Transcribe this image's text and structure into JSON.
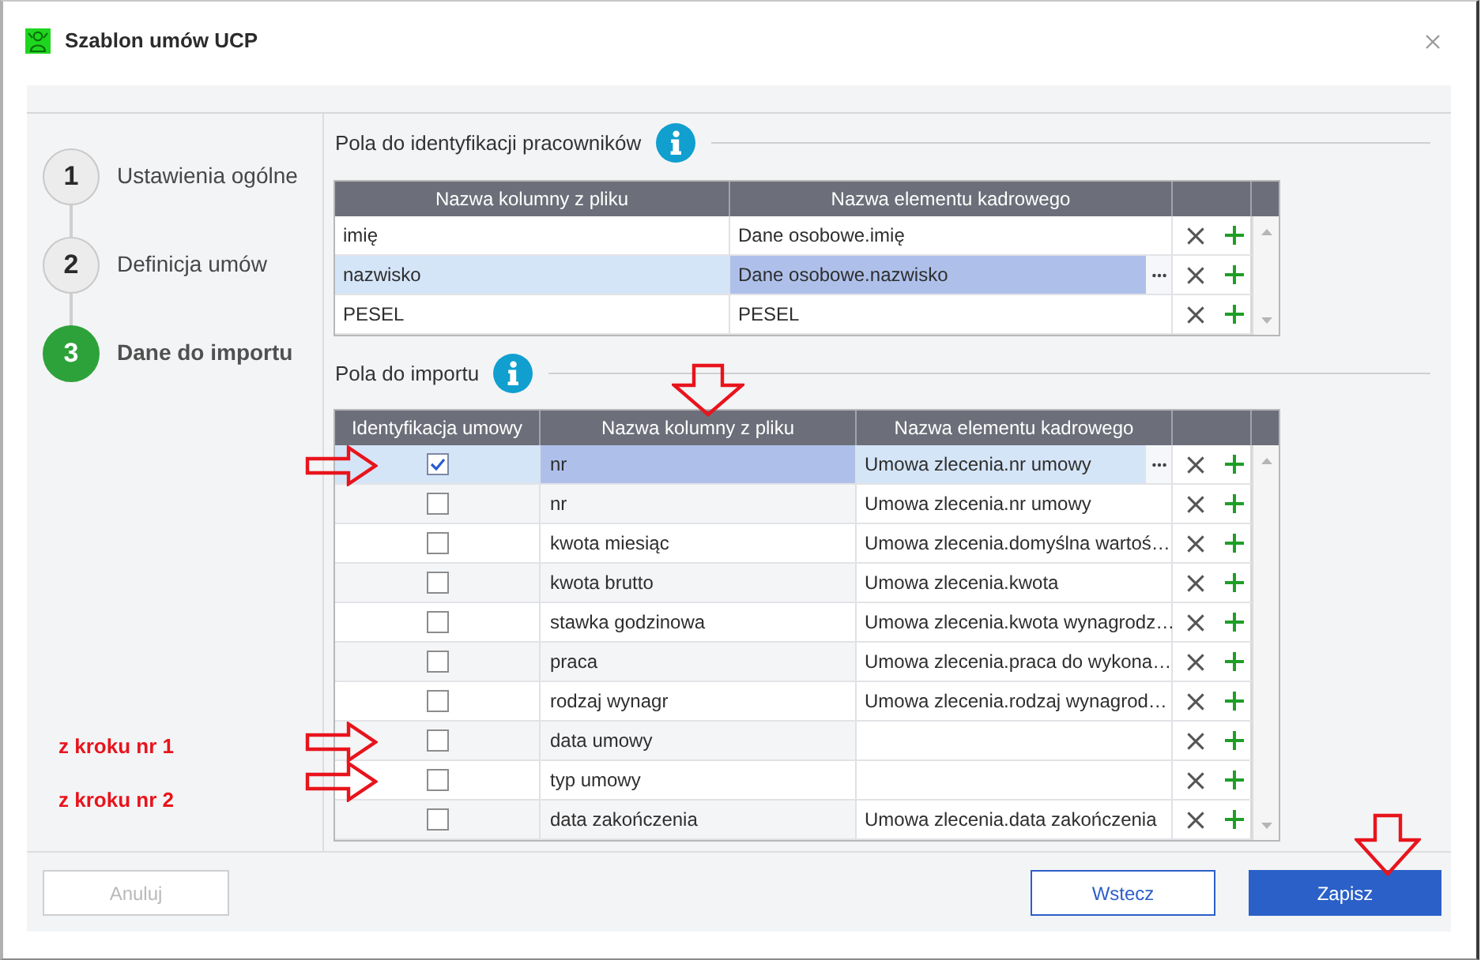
{
  "window": {
    "title": "Szablon umów UCP"
  },
  "steps": [
    {
      "number": "1",
      "label": "Ustawienia ogólne",
      "selected": false
    },
    {
      "number": "2",
      "label": "Definicja umów",
      "selected": false
    },
    {
      "number": "3",
      "label": "Dane do importu",
      "selected": true
    }
  ],
  "employee_fields": {
    "title": "Pola do identyfikacji pracowników",
    "columns": [
      {
        "kind": "text",
        "label": "Nazwa kolumny z pliku"
      },
      {
        "kind": "text",
        "label": "Nazwa elementu kadrowego"
      }
    ],
    "rows": [
      {
        "selected": false,
        "cells": [
          {
            "text": "imię",
            "focused": false
          },
          {
            "text": "Dane osobowe.imię",
            "focused": false
          }
        ]
      },
      {
        "selected": true,
        "cells": [
          {
            "text": "nazwisko",
            "focused": false
          },
          {
            "text": "Dane osobowe.nazwisko",
            "focused": true
          }
        ]
      },
      {
        "selected": false,
        "cells": [
          {
            "text": "PESEL",
            "focused": false
          },
          {
            "text": "PESEL",
            "focused": false
          }
        ]
      }
    ]
  },
  "import_fields": {
    "title": "Pola do importu",
    "columns": [
      {
        "kind": "check",
        "label": "Identyfikacja umowy",
        "marked": false
      },
      {
        "kind": "text",
        "label": "Nazwa kolumny z pliku",
        "marked": true
      },
      {
        "kind": "text",
        "label": "Nazwa elementu kadrowego",
        "marked": false
      }
    ],
    "rows": [
      {
        "selected": true,
        "marked": true,
        "checked": true,
        "cells": [
          {
            "text": "nr",
            "focused": true
          },
          {
            "text": "Umowa zlecenia.nr umowy",
            "focused": false
          }
        ]
      },
      {
        "selected": false,
        "marked": false,
        "checked": false,
        "cells": [
          {
            "text": "nr",
            "focused": false
          },
          {
            "text": "Umowa zlecenia.nr umowy",
            "focused": false
          }
        ]
      },
      {
        "selected": false,
        "marked": false,
        "checked": false,
        "cells": [
          {
            "text": "kwota miesiąc",
            "focused": false
          },
          {
            "text": "Umowa zlecenia.domyślna wartoś…",
            "focused": false
          }
        ]
      },
      {
        "selected": false,
        "marked": false,
        "checked": false,
        "cells": [
          {
            "text": "kwota brutto",
            "focused": false
          },
          {
            "text": "Umowa zlecenia.kwota",
            "focused": false
          }
        ]
      },
      {
        "selected": false,
        "marked": false,
        "checked": false,
        "cells": [
          {
            "text": "stawka godzinowa",
            "focused": false
          },
          {
            "text": "Umowa zlecenia.kwota wynagrodz…",
            "focused": false
          }
        ]
      },
      {
        "selected": false,
        "marked": false,
        "checked": false,
        "cells": [
          {
            "text": "praca",
            "focused": false
          },
          {
            "text": "Umowa zlecenia.praca do wykona…",
            "focused": false
          }
        ]
      },
      {
        "selected": false,
        "marked": false,
        "checked": false,
        "cells": [
          {
            "text": "rodzaj wynagr",
            "focused": false
          },
          {
            "text": "Umowa zlecenia.rodzaj wynagrod…",
            "focused": false
          }
        ]
      },
      {
        "selected": false,
        "marked": true,
        "note": "z kroku nr 1",
        "checked": false,
        "cells": [
          {
            "text": "data umowy",
            "focused": false
          }
        ]
      },
      {
        "selected": false,
        "marked": true,
        "note": "z kroku nr 2",
        "checked": false,
        "cells": [
          {
            "text": "typ umowy",
            "focused": false
          }
        ]
      },
      {
        "selected": false,
        "marked": false,
        "checked": false,
        "cells": [
          {
            "text": "data zakończenia",
            "focused": false
          },
          {
            "text": "Umowa zlecenia.data zakończenia",
            "focused": false
          }
        ]
      }
    ]
  },
  "footer": {
    "buttons": [
      {
        "label": "Anuluj",
        "kind": "secondary",
        "disabled": true,
        "marked": false
      },
      {
        "label": "Wstecz",
        "kind": "secondary",
        "disabled": false,
        "marked": false
      },
      {
        "label": "Zapisz",
        "kind": "primary",
        "disabled": false,
        "marked": true
      }
    ]
  }
}
